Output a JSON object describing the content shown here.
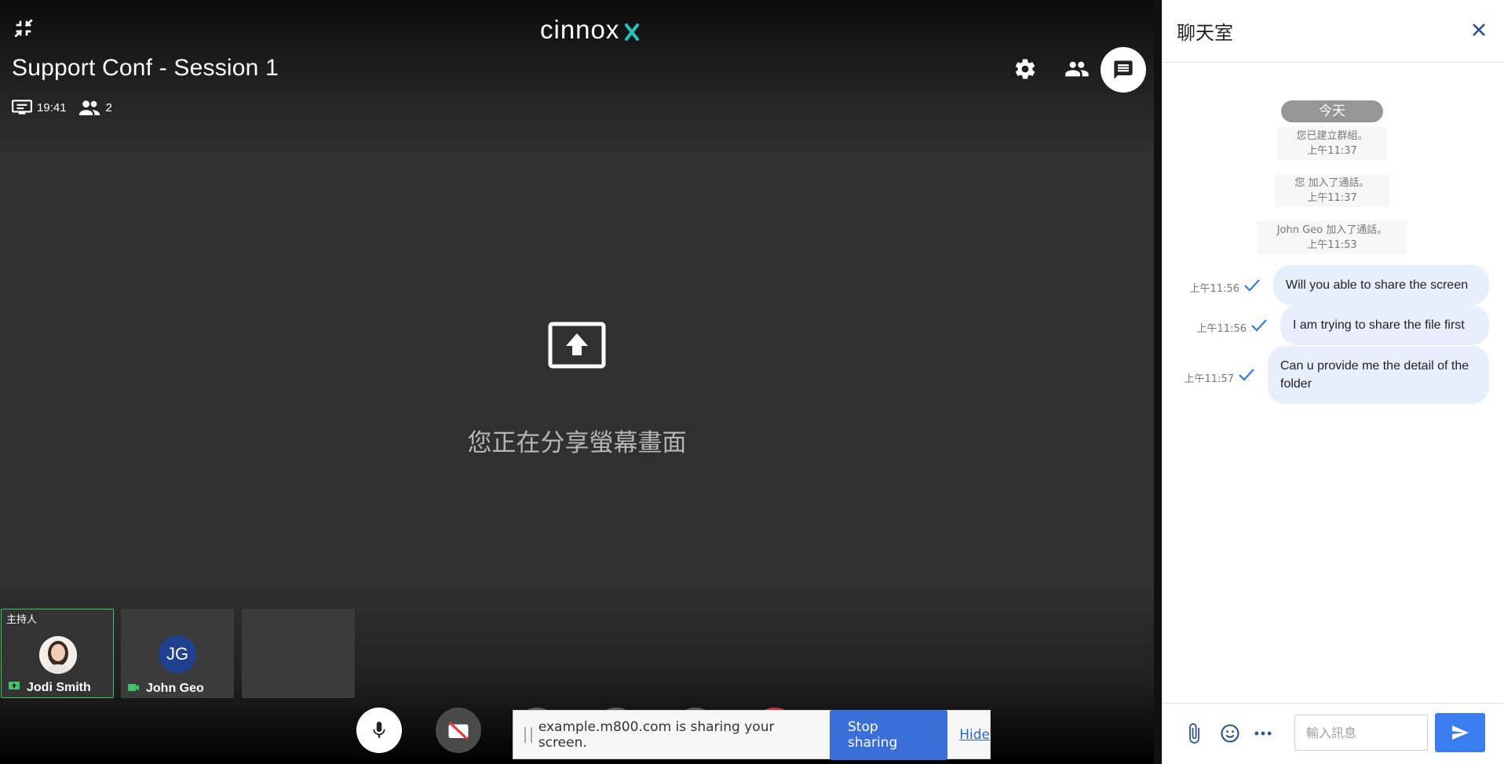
{
  "conference": {
    "brand": "cinnox",
    "title": "Support Conf - Session 1",
    "duration": "19:41",
    "participant_count": "2",
    "sharing_message": "您正在分享螢幕畫面",
    "tiles": [
      {
        "tag": "主持人",
        "name": "Jodi Smith",
        "status": "screen-share-icon"
      },
      {
        "initials": "JG",
        "name": "John Geo",
        "status": "video-icon"
      }
    ]
  },
  "share_bar": {
    "message": "example.m800.com is sharing your screen.",
    "stop_label": "Stop sharing",
    "hide_label": "Hide"
  },
  "chat": {
    "title": "聊天室",
    "day_label": "今天",
    "system_messages": [
      {
        "text": "您已建立群組。",
        "time": "上午11:37"
      },
      {
        "text": "您 加入了通話。",
        "time": "上午11:37"
      },
      {
        "text": "John Geo 加入了通話。",
        "time": "上午11:53"
      }
    ],
    "messages": [
      {
        "text": "Will you able to share the screen",
        "time": "上午11:56"
      },
      {
        "text": "I am trying to share the file first",
        "time": "上午11:56"
      },
      {
        "text": "Can u provide me the detail of the folder",
        "time": "上午11:57"
      }
    ],
    "input_placeholder": "輸入訊息"
  },
  "colors": {
    "accent": "#3a7ef0",
    "bubble": "#e8effc",
    "host_border": "#3fc46a",
    "stop_button": "#3b6fd8"
  }
}
